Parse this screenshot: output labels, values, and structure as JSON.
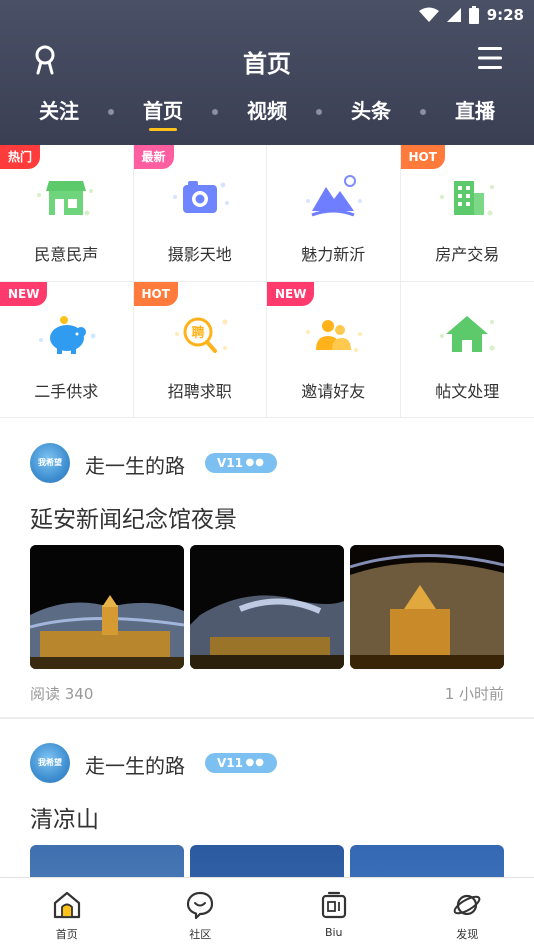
{
  "status": {
    "time": "9:28"
  },
  "header": {
    "title": "首页"
  },
  "tabs": [
    {
      "label": "关注"
    },
    {
      "label": "首页"
    },
    {
      "label": "视频"
    },
    {
      "label": "头条"
    },
    {
      "label": "直播"
    }
  ],
  "grid": [
    {
      "label": "民意民声",
      "badge": "热门",
      "badge_color": "#ff3b3b",
      "icon": "store-icon"
    },
    {
      "label": "摄影天地",
      "badge": "最新",
      "badge_color": "#ff5fa0",
      "icon": "camera-icon"
    },
    {
      "label": "魅力新沂",
      "badge": "",
      "icon": "mountain-icon"
    },
    {
      "label": "房产交易",
      "badge": "HOT",
      "badge_color": "#ff7a3b",
      "icon": "building-icon"
    },
    {
      "label": "二手供求",
      "badge": "NEW",
      "badge_color": "#ff3b6e",
      "icon": "piggy-bank-icon"
    },
    {
      "label": "招聘求职",
      "badge": "HOT",
      "badge_color": "#ff7a3b",
      "icon": "job-search-icon"
    },
    {
      "label": "邀请好友",
      "badge": "NEW",
      "badge_color": "#ff3b6e",
      "icon": "invite-friends-icon"
    },
    {
      "label": "帖文处理",
      "badge": "",
      "icon": "home-icon"
    }
  ],
  "posts": [
    {
      "avatar_text": "我希望",
      "username": "走一生的路",
      "vip": "V11",
      "title": "延安新闻纪念馆夜景",
      "reads": "阅读 340",
      "time": "1 小时前"
    },
    {
      "avatar_text": "我希望",
      "username": "走一生的路",
      "vip": "V11",
      "title": "清凉山"
    }
  ],
  "bottom_nav": [
    {
      "label": "首页",
      "icon": "home-icon"
    },
    {
      "label": "社区",
      "icon": "chat-bubble-icon"
    },
    {
      "label": "Biu",
      "icon": "biu-icon"
    },
    {
      "label": "发现",
      "icon": "planet-icon"
    }
  ],
  "colors": {
    "header_bg": "#444a5f",
    "accent": "#ffc21a"
  }
}
